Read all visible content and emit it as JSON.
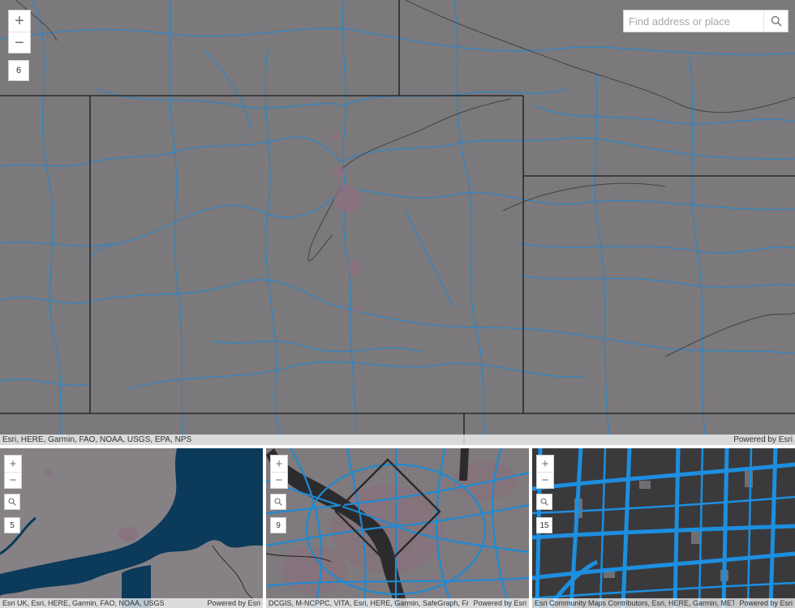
{
  "main_map": {
    "zoom_in": "+",
    "zoom_out": "−",
    "zoom_level": "6",
    "search_placeholder": "Find address or place",
    "attribution": "Esri, HERE, Garmin, FAO, NOAA, USGS, EPA, NPS",
    "powered_by": "Powered by Esri",
    "colors": {
      "land": "#7b797b",
      "roads": "#2e86c8",
      "borders": "#2f2f2f"
    }
  },
  "mini_maps": [
    {
      "zoom_in": "+",
      "zoom_out": "−",
      "zoom_level": "5",
      "attribution": "Esri UK, Esri, HERE, Garmin, FAO, NOAA, USGS",
      "powered_by": "Powered by Esri",
      "colors": {
        "land": "#858185",
        "water": "#0b3a5a"
      }
    },
    {
      "zoom_in": "+",
      "zoom_out": "−",
      "zoom_level": "9",
      "attribution": "DCGIS, M-NCPPC, VITA, Esri, HERE, Garmin, SafeGraph, FAO,",
      "powered_by": "Powered by Esri",
      "colors": {
        "land": "#7f7a7e",
        "roads": "#1f8ad2",
        "water": "#2b2b2d"
      }
    },
    {
      "zoom_in": "+",
      "zoom_out": "−",
      "zoom_level": "15",
      "attribution": "Esri Community Maps Contributors, Esri, HERE, Garmin, METI/",
      "powered_by": "Powered by Esri",
      "colors": {
        "blocks": "#3a3a3c",
        "roads": "#1d8fe0",
        "gaps": "#6f6f72"
      }
    }
  ]
}
